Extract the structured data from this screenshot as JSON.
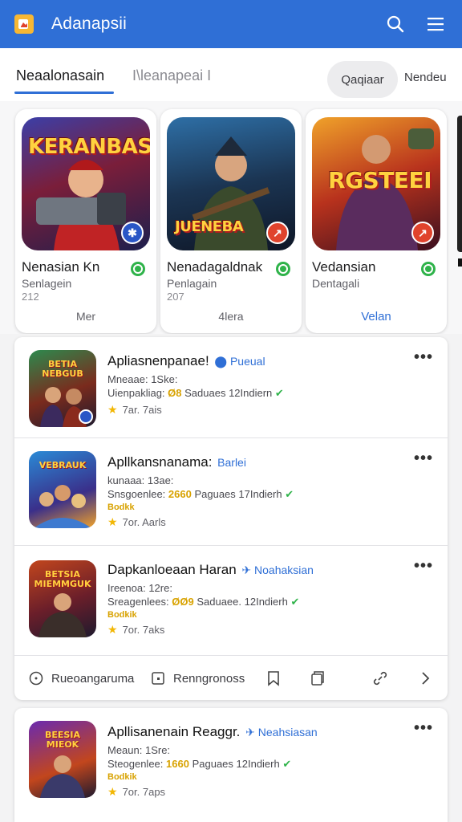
{
  "header": {
    "title": "Adanapsii",
    "icons": [
      "app-logo-icon",
      "search-icon",
      "menu-icon"
    ],
    "accent": "#2f6fd6"
  },
  "tabs": {
    "items": [
      "Neaalonasain",
      "I\\leanapeai I"
    ],
    "pill_label": "Qaqiaar",
    "extra_label": "Nendeu"
  },
  "featured": [
    {
      "art_title": "KERANBASA",
      "name": "Nenasian Kn",
      "subtitle": "Senlagein",
      "number": "212",
      "action": "Mer",
      "badge_color": "#2a56c6"
    },
    {
      "art_title": "JUENEBA",
      "name": "Nenadagaldnak",
      "subtitle": "Penlagain",
      "number": "207",
      "action": "4lera",
      "badge_color": "#e0432c"
    },
    {
      "art_title": "RGSTEEI",
      "name": "Vedansian",
      "subtitle": "Dentagali",
      "number": "",
      "action": "Velan",
      "badge_color": "#e0432c"
    }
  ],
  "list": [
    {
      "icon_title": "BETIA NEBGUB",
      "title": "Apliasnenpanae!",
      "tag": "Pueual",
      "line1": "Mneaae: 1Ske:",
      "line2_a": "Uienpakliag:",
      "line2_num": "Ø8",
      "line2_b": "Saduaes 12Indiern",
      "badge": "",
      "rating": "7ar. 7ais"
    },
    {
      "icon_title": "VEBRAUK",
      "title": "Apllkansnanama:",
      "tag": "Barlei",
      "line1": "kunaaa: 13ae:",
      "line2_a": "Snsgoenlee:",
      "line2_num": "2660",
      "line2_b": "Paguaes 17Indierh",
      "badge": "Bodkk",
      "rating": "7or. Aarls"
    },
    {
      "icon_title": "BETSIA MIEMMGUK",
      "title": "Dapkanloeaan Haran",
      "tag": "Noahaksian",
      "line1": "Ireenoa: 12re:",
      "line2_a": "Sreagenlees:",
      "line2_num": "ØØ9",
      "line2_b": "Saduaee. 12Indierh",
      "badge": "Bodkik",
      "rating": "7or. 7aks"
    }
  ],
  "actions": [
    "Rueoangaruma",
    "Renngronoss"
  ],
  "list2": {
    "icon_title": "BEESIA MIEOK",
    "title": "Apllisanenain Reaggr.",
    "tag": "Neahsiasan",
    "line1": "Meaun: 1Sre:",
    "line2_a": "Steogenlee:",
    "line2_num": "1660",
    "line2_b": "Paguaes 12Indierh",
    "badge": "Bodkik",
    "rating": "7or. 7aps"
  }
}
